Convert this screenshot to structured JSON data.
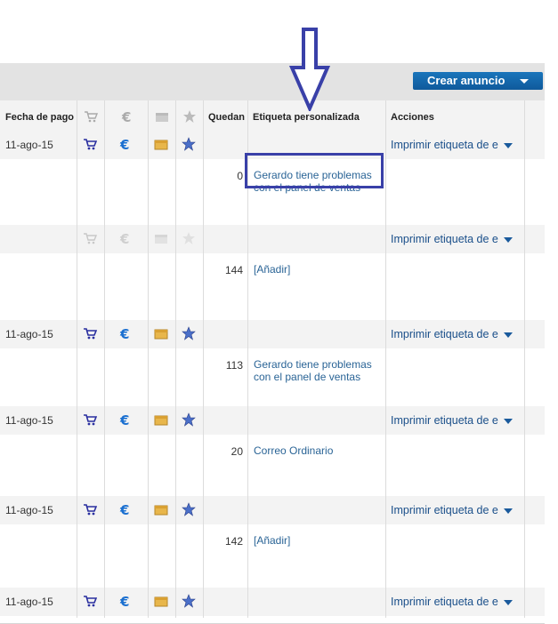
{
  "toolbar": {
    "create_label": "Crear anuncio"
  },
  "columns": {
    "payment_date": "Fecha de pago",
    "remaining": "Quedan",
    "custom_label": "Etiqueta personalizada",
    "actions": "Acciones"
  },
  "rows": [
    {
      "date": "11-ago-15",
      "active": true,
      "qty": "0",
      "label": "Gerardo tiene problemas con el panel de ventas",
      "action": "Imprimir etiqueta de e"
    },
    {
      "date": "",
      "active": false,
      "qty": "144",
      "label": "[Añadir]",
      "action": "Imprimir etiqueta de e"
    },
    {
      "date": "11-ago-15",
      "active": true,
      "qty": "113",
      "label": "Gerardo tiene problemas con el panel de ventas",
      "action": "Imprimir etiqueta de e"
    },
    {
      "date": "11-ago-15",
      "active": true,
      "qty": "20",
      "label": "Correo Ordinario",
      "action": "Imprimir etiqueta de e"
    },
    {
      "date": "11-ago-15",
      "active": true,
      "qty": "142",
      "label": "[Añadir]",
      "action": "Imprimir etiqueta de e"
    },
    {
      "date": "11-ago-15",
      "active": true,
      "qty": "",
      "label": "",
      "action": "Imprimir etiqueta de e"
    }
  ],
  "icons": [
    "cart-icon",
    "euro-icon",
    "package-icon",
    "star-icon"
  ],
  "colors": {
    "accent": "#1a75bb",
    "highlight": "#3940a8",
    "link": "#2a6496"
  }
}
